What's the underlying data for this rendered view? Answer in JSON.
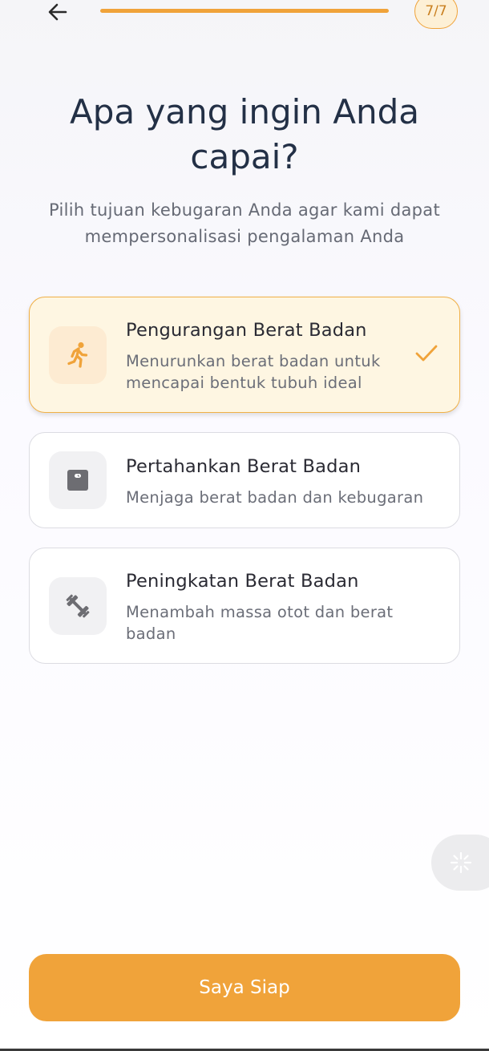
{
  "header": {
    "back_icon": "arrow-left-icon",
    "progress_fraction": 1.0,
    "step_label": "7/7",
    "accent_color": "#f0a33a"
  },
  "title": "Apa yang ingin Anda capai?",
  "subtitle": "Pilih tujuan kebugaran Anda agar kami dapat mempersonalisasi pengalaman Anda",
  "goals": [
    {
      "title": "Pengurangan Berat Badan",
      "description": "Menurunkan berat badan untuk mencapai bentuk tubuh ideal",
      "icon": "running-person-icon",
      "selected": true
    },
    {
      "title": "Pertahankan Berat Badan",
      "description": "Menjaga berat badan dan kebugaran",
      "icon": "scale-icon",
      "selected": false
    },
    {
      "title": "Peningkatan Berat Badan",
      "description": "Menambah massa otot dan berat badan",
      "icon": "dumbbell-icon",
      "selected": false
    }
  ],
  "floating_button_icon": "sparkle-icon",
  "cta_label": "Saya Siap"
}
